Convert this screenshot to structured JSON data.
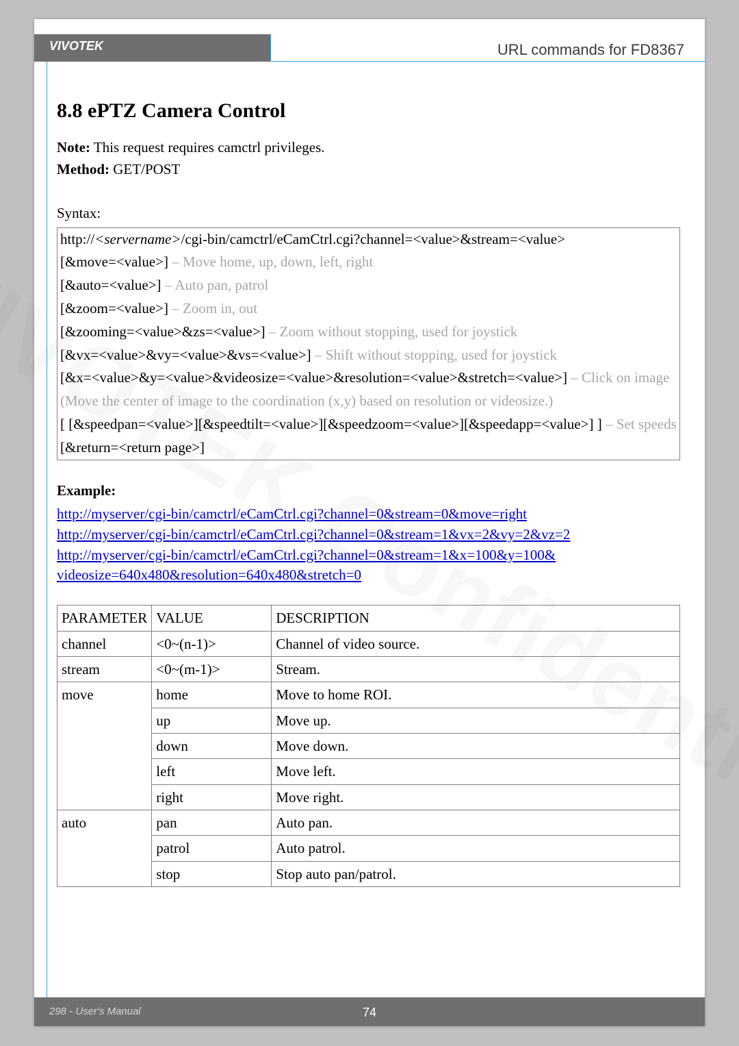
{
  "header": {
    "brand": "VIVOTEK",
    "title": "URL commands for FD8367"
  },
  "section": {
    "heading": "8.8 ePTZ Camera Control",
    "note_label": "Note:",
    "note_text": " This request requires camctrl privileges.",
    "method_label": "Method:",
    "method_value": " GET/POST",
    "syntax_label": "Syntax:"
  },
  "syntax": {
    "line1_a": "http://",
    "line1_b": "<servername>",
    "line1_c": "/cgi-bin/camctrl/eCamCtrl.cgi?channel=<value>&stream=<value>",
    "line2_a": "[&move=<value>]",
    "line2_b": " – Move home, up, down, left, right",
    "line3_a": "[&auto=<value>]",
    "line3_b": " – Auto pan, patrol",
    "line4_a": "[&zoom=<value>]",
    "line4_b": " – Zoom in, out",
    "line5_a": "[&zooming=<value>&zs=<value>]",
    "line5_b": " – Zoom without stopping, used for joystick",
    "line6_a": "[&vx=<value>&vy=<value>&vs=<value>]",
    "line6_b": " – Shift without stopping, used for joystick",
    "line7_a": "[&x=<value>&y=<value>&videosize=<value>&resolution=<value>&stretch=<value>]",
    "line7_b": " – Click on image",
    "line8": "(Move the center of image to the coordination (x,y) based on resolution or videosize.)",
    "line9_a": "[ [&speedpan=<value>][&speedtilt=<value>][&speedzoom=<value>][&speedapp=<value>] ]",
    "line9_b": " – Set speeds",
    "line10": "[&return=<return page>]"
  },
  "example": {
    "label": "Example:",
    "link1": "http://myserver/cgi-bin/camctrl/eCamCtrl.cgi?channel=0&stream=0&move=right",
    "link2": "http://myserver/cgi-bin/camctrl/eCamCtrl.cgi?channel=0&stream=1&vx=2&vy=2&vz=2",
    "link3a": "http://myserver/cgi-bin/camctrl/eCamCtrl.cgi?channel=0&stream=1&x=100&y=100&",
    "link3b": "videosize=640x480&resolution=640x480&stretch=0"
  },
  "table": {
    "headers": {
      "param": "PARAMETER",
      "value": "VALUE",
      "desc": "DESCRIPTION"
    },
    "rows": [
      {
        "param": "channel",
        "value": "<0~(n-1)>",
        "desc": "Channel of video source."
      },
      {
        "param": "stream",
        "value": "<0~(m-1)>",
        "desc": "Stream."
      },
      {
        "param": "move",
        "value": "home",
        "desc": "Move to home ROI."
      },
      {
        "param": "",
        "value": "up",
        "desc": "Move up."
      },
      {
        "param": "",
        "value": "down",
        "desc": "Move down."
      },
      {
        "param": "",
        "value": "left",
        "desc": "Move left."
      },
      {
        "param": "",
        "value": "right",
        "desc": "Move right."
      },
      {
        "param": "auto",
        "value": "pan",
        "desc": "Auto pan."
      },
      {
        "param": "",
        "value": "patrol",
        "desc": "Auto patrol."
      },
      {
        "param": "",
        "value": "stop",
        "desc": "Stop auto pan/patrol."
      }
    ]
  },
  "footer": {
    "left": "298 - User's Manual",
    "center": "74"
  },
  "watermark": "VIVOTEK Confidential"
}
